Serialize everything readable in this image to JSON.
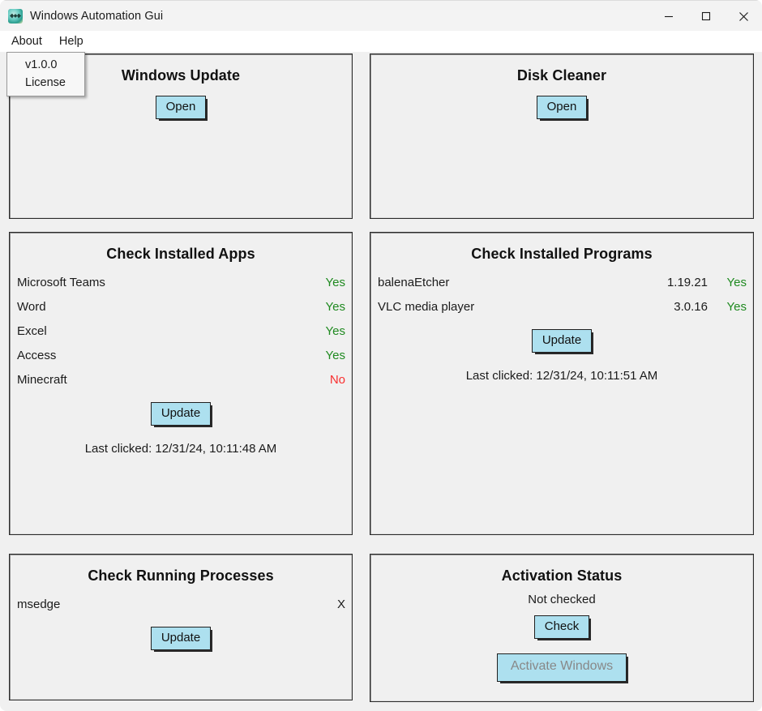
{
  "window": {
    "title": "Windows Automation Gui",
    "icon": "app-feather-icon",
    "controls": {
      "minimize": "minimize-icon",
      "maximize": "maximize-icon",
      "close": "close-icon"
    }
  },
  "menubar": {
    "items": [
      {
        "label": "About"
      },
      {
        "label": "Help"
      }
    ]
  },
  "dropdown": {
    "open_under": "About",
    "items": [
      {
        "label": "v1.0.0"
      },
      {
        "label": "License"
      }
    ]
  },
  "panels": {
    "windows_update": {
      "title": "Windows Update",
      "open_label": "Open"
    },
    "disk_cleaner": {
      "title": "Disk Cleaner",
      "open_label": "Open"
    },
    "installed_apps": {
      "title": "Check Installed Apps",
      "update_label": "Update",
      "last_clicked": "Last clicked: 12/31/24, 10:11:48 AM",
      "rows": [
        {
          "name": "Microsoft Teams",
          "status": "Yes",
          "state": "yes"
        },
        {
          "name": "Word",
          "status": "Yes",
          "state": "yes"
        },
        {
          "name": "Excel",
          "status": "Yes",
          "state": "yes"
        },
        {
          "name": "Access",
          "status": "Yes",
          "state": "yes"
        },
        {
          "name": "Minecraft",
          "status": "No",
          "state": "no"
        }
      ]
    },
    "installed_programs": {
      "title": "Check Installed Programs",
      "update_label": "Update",
      "last_clicked": "Last clicked: 12/31/24, 10:11:51 AM",
      "rows": [
        {
          "name": "balenaEtcher",
          "version": "1.19.21",
          "status": "Yes",
          "state": "yes"
        },
        {
          "name": "VLC media player",
          "version": "3.0.16",
          "status": "Yes",
          "state": "yes"
        }
      ]
    },
    "running_processes": {
      "title": "Check Running Processes",
      "update_label": "Update",
      "rows": [
        {
          "name": "msedge",
          "status": "X",
          "state": "x"
        }
      ]
    },
    "activation_status": {
      "title": "Activation Status",
      "status": "Not checked",
      "check_label": "Check",
      "activate_label": "Activate Windows",
      "activate_disabled": true
    }
  },
  "colors": {
    "button_fill": "#ade0ef",
    "yes": "#1f8a20",
    "no": "#f92f2f",
    "window_bg": "#f0f0f0",
    "titlebar_bg": "#f3f3f3",
    "menubar_bg": "#ffffff"
  }
}
